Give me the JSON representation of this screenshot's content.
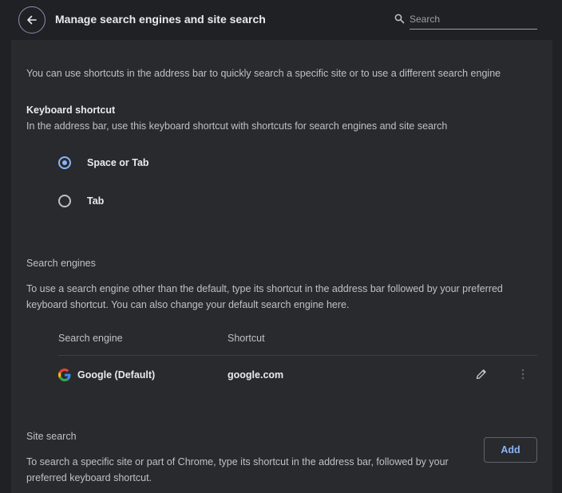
{
  "header": {
    "title": "Manage search engines and site search",
    "search_placeholder": "Search"
  },
  "intro": "You can use shortcuts in the address bar to quickly search a specific site or to use a different search engine",
  "keyboard_shortcut": {
    "title": "Keyboard shortcut",
    "description": "In the address bar, use this keyboard shortcut with shortcuts for search engines and site search",
    "options": [
      {
        "label": "Space or Tab",
        "checked": true
      },
      {
        "label": "Tab",
        "checked": false
      }
    ]
  },
  "search_engines": {
    "title": "Search engines",
    "description_line1": "To use a search engine other than the default, type its shortcut in the address bar followed by your preferred",
    "description_line2": "keyboard shortcut. You can also change your default search engine here.",
    "columns": [
      "Search engine",
      "Shortcut"
    ],
    "rows": [
      {
        "name": "Google (Default)",
        "shortcut": "google.com",
        "icon": "google-logo"
      }
    ]
  },
  "site_search": {
    "title": "Site search",
    "add_label": "Add",
    "description_line1": "To search a specific site or part of Chrome, type its shortcut in the address bar, followed by your",
    "description_line2": "preferred keyboard shortcut."
  },
  "colors": {
    "background": "#202124",
    "card": "#292a2d",
    "accent": "#8ab4f8",
    "back_button_ring": "#8a8eb5"
  }
}
